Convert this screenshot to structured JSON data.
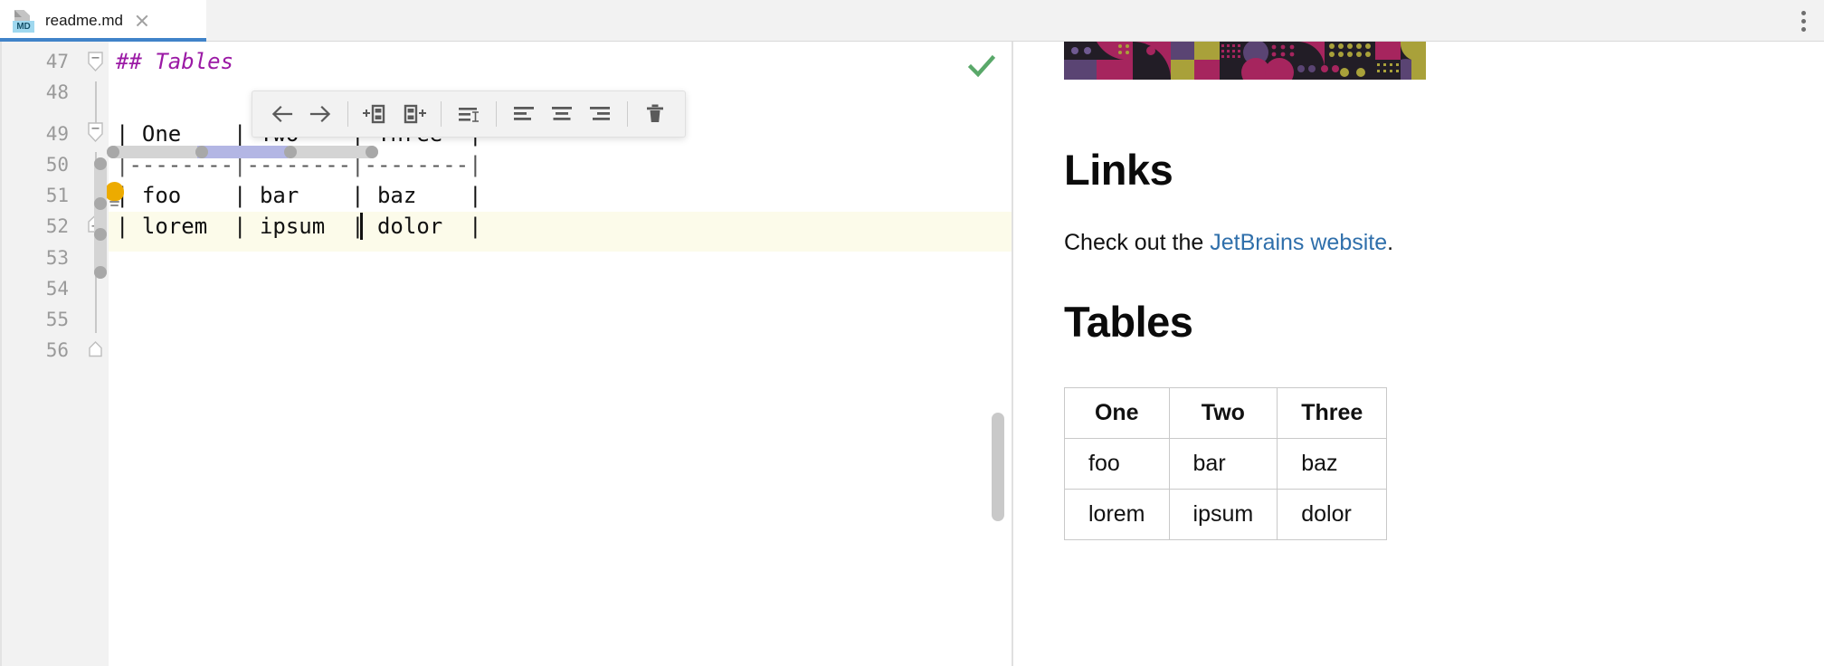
{
  "window": {
    "tab": {
      "filename": "readme.md",
      "filetype_badge": "MD",
      "close_icon": "close-icon",
      "active_underline_color": "#4083c9"
    },
    "overflow_menu_icon": "kebab-menu-icon"
  },
  "editor": {
    "language": "markdown",
    "highlighted_line": 52,
    "caret_line": 52,
    "caret_after_text": "dolor",
    "inspection_status": {
      "icon": "checkmark-icon",
      "color": "#59a869",
      "label": "No problems found"
    },
    "intention_bulb": {
      "icon": "lightbulb-icon",
      "color": "#edab00",
      "line": 51
    },
    "lines": [
      {
        "number": "47",
        "text": "## Tables",
        "kind": "heading",
        "fold": true
      },
      {
        "number": "48",
        "text": "",
        "kind": "blank",
        "fold": false
      },
      {
        "number": "49",
        "text": "| One    | Two    | Three  |",
        "kind": "table",
        "fold": true
      },
      {
        "number": "50",
        "text": "|--------|--------|--------|",
        "kind": "separator",
        "fold": false
      },
      {
        "number": "51",
        "text": "| foo    | bar    | baz    |",
        "kind": "table",
        "fold": false
      },
      {
        "number": "52",
        "text": "| lorem  | ipsum  | dolor  |",
        "kind": "table",
        "fold": true
      },
      {
        "number": "53",
        "text": "",
        "kind": "blank",
        "fold": false
      },
      {
        "number": "54",
        "text": "",
        "kind": "blank",
        "fold": false
      },
      {
        "number": "55",
        "text": "",
        "kind": "blank",
        "fold": false
      },
      {
        "number": "56",
        "text": "",
        "kind": "blank",
        "fold": true
      }
    ]
  },
  "table_toolbar": {
    "buttons": [
      {
        "name": "move-column-left-button",
        "icon": "arrow-left-icon",
        "label": "Move Column Left"
      },
      {
        "name": "move-column-right-button",
        "icon": "arrow-right-icon",
        "label": "Move Column Right"
      },
      {
        "separator_after": true
      },
      {
        "name": "insert-column-before-button",
        "icon": "add-column-before-icon",
        "label": "Insert Column Before"
      },
      {
        "name": "insert-column-after-button",
        "icon": "add-column-after-icon",
        "label": "Insert Column After"
      },
      {
        "separator_after": true
      },
      {
        "name": "reformat-table-button",
        "icon": "reformat-table-icon",
        "label": "Reformat Table"
      },
      {
        "separator_after": true
      },
      {
        "name": "align-left-button",
        "icon": "align-left-icon",
        "label": "Align Left"
      },
      {
        "name": "align-center-button",
        "icon": "align-center-icon",
        "label": "Align Center"
      },
      {
        "name": "align-right-button",
        "icon": "align-right-icon",
        "label": "Align Right"
      },
      {
        "separator_after": true
      },
      {
        "name": "delete-column-button",
        "icon": "trash-icon",
        "label": "Delete Column"
      }
    ]
  },
  "table_selection": {
    "active_column_index": 1,
    "column_handle_count": 4,
    "row_handle_count": 4,
    "active_color": "#b3b6e4",
    "strip_color": "#d4d4d4",
    "handle_color": "#a8a8a8"
  },
  "preview": {
    "banner_alt": "decorative geometric pattern banner",
    "headings": {
      "links": "Links",
      "tables": "Tables"
    },
    "paragraph": {
      "before_link": "Check out the ",
      "link_text": "JetBrains website",
      "after_link": ".",
      "link_color": "#2f6fab"
    },
    "table": {
      "headers": [
        "One",
        "Two",
        "Three"
      ],
      "rows": [
        [
          "foo",
          "bar",
          "baz"
        ],
        [
          "lorem",
          "ipsum",
          "dolor"
        ]
      ]
    }
  }
}
